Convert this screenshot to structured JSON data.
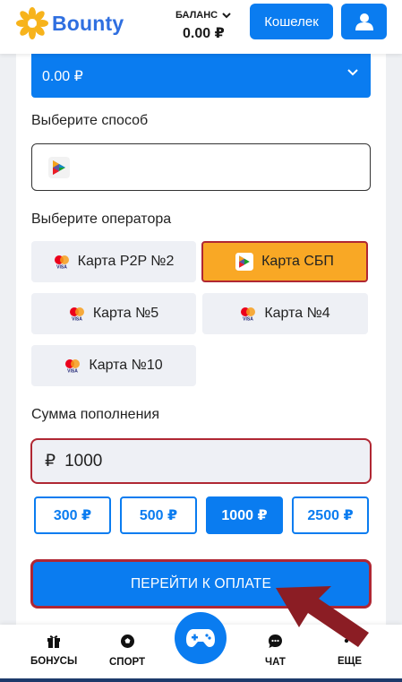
{
  "header": {
    "logo_text": "Bounty",
    "balance_label": "БАЛАНС",
    "balance_value": "0.00 ₽",
    "wallet_button": "Кошелек"
  },
  "form": {
    "amount_select_value": "0.00 ₽",
    "method_label": "Выберите способ",
    "operator_label": "Выберите оператора",
    "operators": [
      {
        "label": "Карта P2P №2",
        "icon": "mastercard-visa-icon",
        "selected": false
      },
      {
        "label": "Карта СБП",
        "icon": "sbp-icon",
        "selected": true
      },
      {
        "label": "Карта №5",
        "icon": "mastercard-visa-icon",
        "selected": false
      },
      {
        "label": "Карта №4",
        "icon": "mastercard-visa-icon",
        "selected": false
      },
      {
        "label": "Карта №10",
        "icon": "mastercard-visa-icon",
        "selected": false
      }
    ],
    "sum_label": "Сумма пополнения",
    "sum_currency": "₽",
    "sum_value": "1000",
    "quick_amounts": [
      {
        "label": "300 ₽",
        "selected": false
      },
      {
        "label": "500 ₽",
        "selected": false
      },
      {
        "label": "1000 ₽",
        "selected": true
      },
      {
        "label": "2500 ₽",
        "selected": false
      }
    ],
    "pay_button": "ПЕРЕЙТИ К ОПЛАТЕ"
  },
  "bottom_nav": [
    {
      "label": "БОНУСЫ",
      "icon": "gift-icon"
    },
    {
      "label": "СПОРТ",
      "icon": "soccer-ball-icon"
    },
    {
      "label": "",
      "icon": "gamepad-icon"
    },
    {
      "label": "ЧАТ",
      "icon": "chat-icon"
    },
    {
      "label": "ЕЩЕ",
      "icon": "more-dots-icon"
    }
  ],
  "colors": {
    "accent": "#0a7cf0",
    "highlight_border": "#b02733",
    "selected_operator": "#f9a825",
    "logo_sun": "#f7b31b"
  }
}
